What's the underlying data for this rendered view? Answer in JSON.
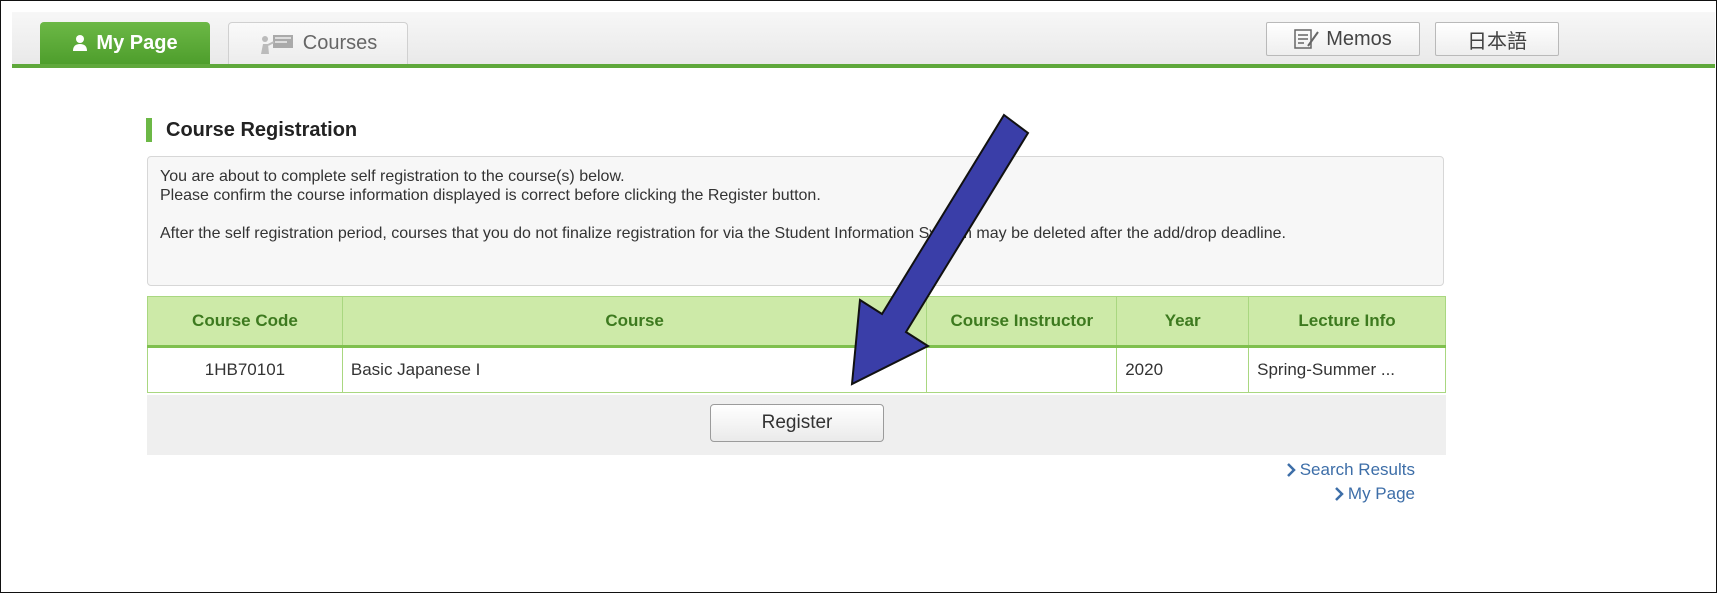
{
  "header": {
    "tabs": [
      {
        "label": "My Page",
        "icon": "user-icon",
        "active": true
      },
      {
        "label": "Courses",
        "icon": "presentation-icon",
        "active": false
      }
    ],
    "memos_label": "Memos",
    "memos_icon": "memo-icon",
    "language_label": "日本語"
  },
  "page": {
    "title": "Course Registration",
    "accent_color": "#6cb846",
    "notice_lines": [
      "You are about to complete self registration to the course(s) below.",
      "Please confirm the course information displayed is correct before clicking the Register button.",
      "After the self registration period, courses that you do not finalize registration for via the Student Information System may be deleted after the add/drop deadline."
    ]
  },
  "table": {
    "headers": [
      "Course Code",
      "Course",
      "Course Instructor",
      "Year",
      "Lecture Info"
    ],
    "rows": [
      {
        "code": "1HB70101",
        "course": "Basic Japanese I",
        "instructor": "",
        "year": "2020",
        "lecture_info": "Spring-Summer ..."
      }
    ]
  },
  "actions": {
    "register_label": "Register"
  },
  "links": {
    "search_results": "Search Results",
    "my_page": "My Page"
  },
  "annotation": {
    "arrow_color": "#3a3ea8"
  }
}
